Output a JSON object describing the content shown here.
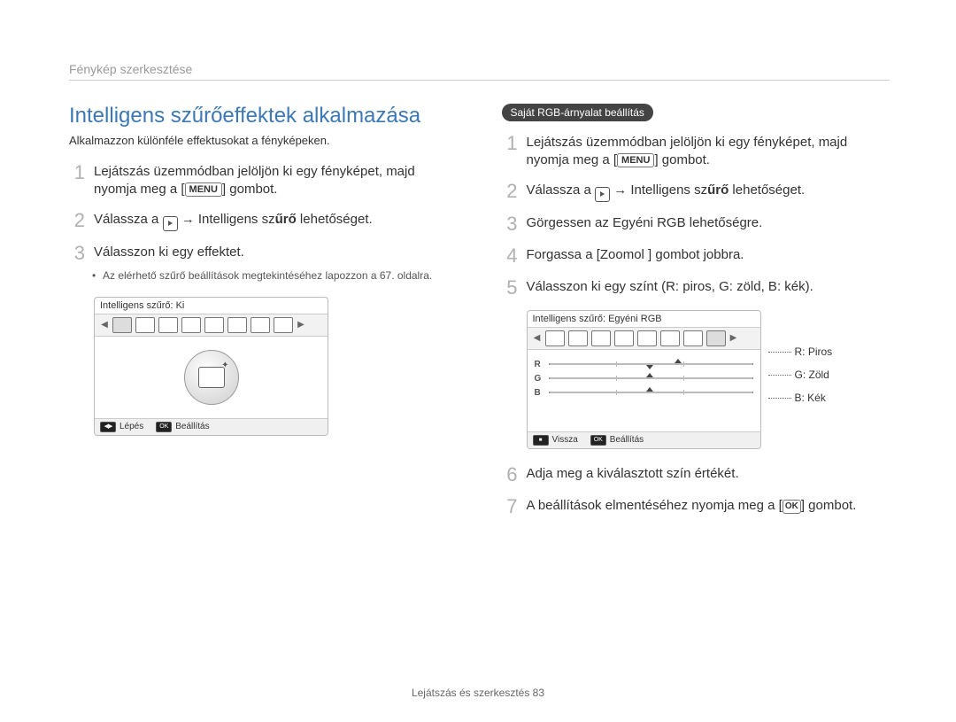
{
  "breadcrumb": "Fénykép szerkesztése",
  "title": "Intelligens szűrőeffektek alkalmazása",
  "description": "Alkalmazzon különféle effektusokat a fényképeken.",
  "left_steps": [
    {
      "n": "1",
      "parts": [
        "Lejátszás üzemmódban jelöljön ki egy fényképet, majd nyomja meg a [",
        {
          "cap": "MENU"
        },
        "] gombot."
      ]
    },
    {
      "n": "2",
      "parts": [
        "Válassza a ",
        {
          "ico": "play"
        },
        " → Intelligens sz",
        {
          "b": "űrő"
        },
        " lehetőséget."
      ]
    },
    {
      "n": "3",
      "parts": [
        "Válasszon ki egy effektet."
      ]
    }
  ],
  "sub_bullet": "Az elérhető szűrő beállítások megtekintéséhez lapozzon a 67. oldalra.",
  "cam_left": {
    "header": "Intelligens szűrő:  Ki",
    "footer_left": "Lépés",
    "footer_right": "Beállítás"
  },
  "pill": "Saját RGB-árnyalat beállítás",
  "right_steps": [
    {
      "n": "1",
      "parts": [
        "Lejátszás üzemmódban jelöljön ki egy fényképet, majd nyomja meg a [",
        {
          "cap": "MENU"
        },
        "] gombot."
      ]
    },
    {
      "n": "2",
      "parts": [
        "Válassza a ",
        {
          "ico": "play"
        },
        " → Intelligens sz",
        {
          "b": "űrő"
        },
        " lehetőséget."
      ]
    },
    {
      "n": "3",
      "parts": [
        "Görgessen az Egyéni RGB lehetőségre."
      ]
    },
    {
      "n": "4",
      "parts": [
        "Forgassa a [Zoomol   ] gombot jobbra."
      ]
    },
    {
      "n": "5",
      "parts": [
        "Válasszon ki egy színt (R: piros, G: zöld, B: kék)."
      ]
    }
  ],
  "right_steps_after": [
    {
      "n": "6",
      "parts": [
        "Adja meg a kiválasztott szín értékét."
      ]
    },
    {
      "n": "7",
      "parts": [
        "A beállítások elmentéséhez nyomja meg a [",
        {
          "cap": "OK"
        },
        "] gombot."
      ]
    }
  ],
  "cam_right": {
    "header": "Intelligens szűrő:  Egyéni RGB",
    "footer_left": "Vissza",
    "footer_right": "Beállítás",
    "channels": [
      "R",
      "G",
      "B"
    ],
    "labels": [
      "R: Piros",
      "G: Zöld",
      "B: Kék"
    ]
  },
  "footer": "Lejátszás és szerkesztés  83"
}
